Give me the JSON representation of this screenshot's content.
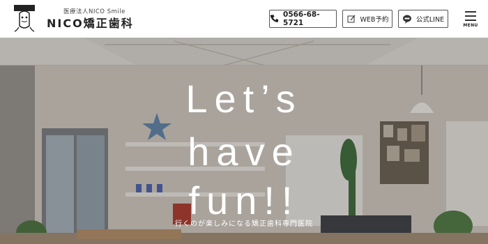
{
  "header": {
    "logo_sub": "医療法人NICO Smile",
    "logo_main": "NICO矯正歯科",
    "phone": "0566-68-5721",
    "web_reserve": "WEB予約",
    "line": "公式LINE",
    "menu": "MENU"
  },
  "hero": {
    "headline_1": "Let’s",
    "headline_2": "have",
    "headline_3": "fun!!",
    "tagline": "行くのが楽しみになる矯正歯科専門医院"
  },
  "colors": {
    "border": "#555555",
    "text": "#222222",
    "hero_text": "#ffffff"
  },
  "icons": [
    "logo-mascot-icon",
    "phone-icon",
    "web-reserve-icon",
    "line-icon",
    "menu-icon"
  ]
}
